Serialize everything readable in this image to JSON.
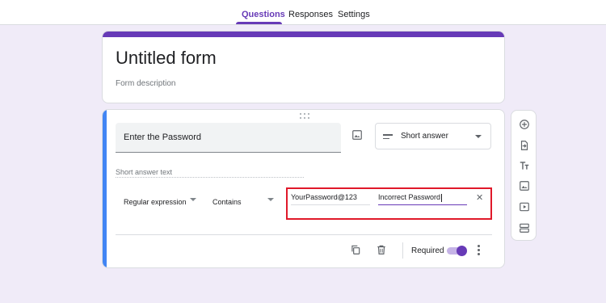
{
  "tabs": [
    {
      "label": "Questions",
      "active": true
    },
    {
      "label": "Responses",
      "active": false
    },
    {
      "label": "Settings",
      "active": false
    }
  ],
  "form": {
    "title": "Untitled form",
    "description_placeholder": "Form description"
  },
  "question": {
    "title": "Enter the Password",
    "type_label": "Short answer",
    "answer_placeholder": "Short answer text",
    "validation": {
      "kind": "Regular expression",
      "condition": "Contains",
      "pattern": "YourPassword@123",
      "error_text": "Incorrect Password"
    },
    "required_label": "Required",
    "required": true
  },
  "colors": {
    "accent": "#673ab7",
    "active_card": "#4285f4",
    "background": "#f0ebf8",
    "highlight": "#e0192a"
  },
  "icons": {
    "image": "image-icon",
    "type_menu": "short-answer-lines-icon",
    "copy": "duplicate-icon",
    "delete": "trash-icon",
    "more": "more-vert-icon",
    "toolbar": [
      "add-circle-icon",
      "import-icon",
      "title-text-icon",
      "image-icon",
      "video-icon",
      "section-icon"
    ]
  }
}
